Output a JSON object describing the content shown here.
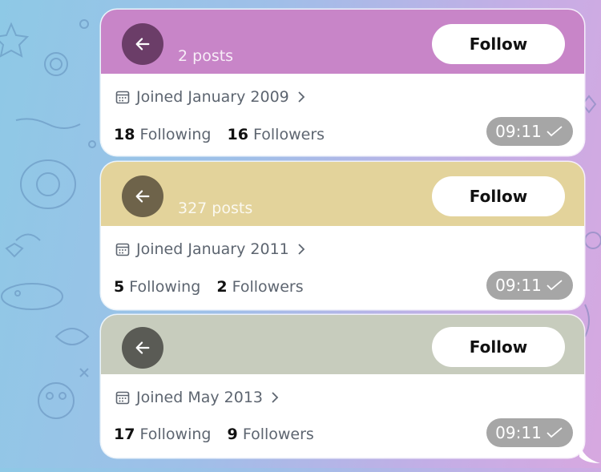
{
  "colors": {
    "card1_banner": "#c885c8",
    "card1_back": "#6b3d68",
    "card2_banner": "#e3d39b",
    "card2_back": "#6e634a",
    "card3_banner": "#c7ccbd",
    "card3_back": "#5a5b55"
  },
  "cards": [
    {
      "posts": "2 posts",
      "follow_label": "Follow",
      "joined": "Joined January 2009",
      "following_count": "18",
      "following_label": "Following",
      "followers_count": "16",
      "followers_label": "Followers",
      "time": "09:11"
    },
    {
      "posts": "327 posts",
      "follow_label": "Follow",
      "joined": "Joined January 2011",
      "following_count": "5",
      "following_label": "Following",
      "followers_count": "2",
      "followers_label": "Followers",
      "time": "09:11"
    },
    {
      "posts": "",
      "follow_label": "Follow",
      "joined": "Joined May 2013",
      "following_count": "17",
      "following_label": "Following",
      "followers_count": "9",
      "followers_label": "Followers",
      "time": "09:11"
    }
  ],
  "icons": {
    "back": "arrow-left-icon",
    "calendar": "calendar-icon",
    "chevron": "chevron-right-icon",
    "read": "checkmark-icon"
  }
}
